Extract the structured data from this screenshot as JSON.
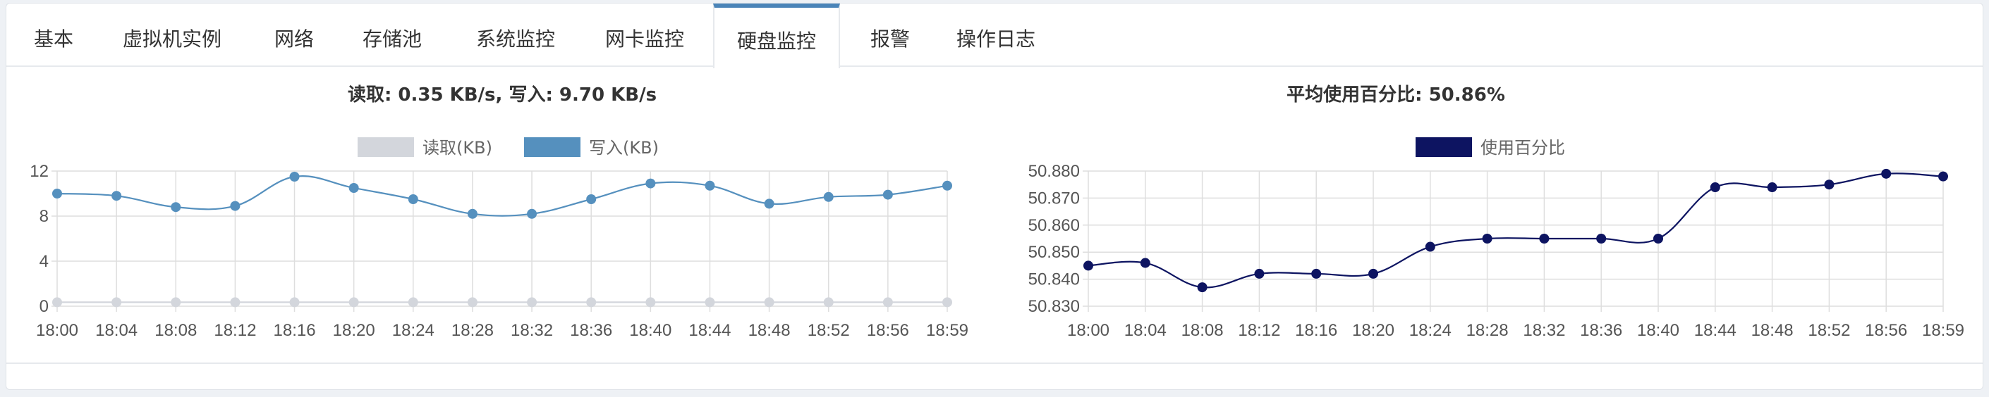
{
  "tabs": [
    {
      "id": "basic",
      "label": "基本"
    },
    {
      "id": "vm",
      "label": "虚拟机实例"
    },
    {
      "id": "network",
      "label": "网络"
    },
    {
      "id": "storage",
      "label": "存储池"
    },
    {
      "id": "sysmon",
      "label": "系统监控"
    },
    {
      "id": "nicmon",
      "label": "网卡监控"
    },
    {
      "id": "diskmon",
      "label": "硬盘监控"
    },
    {
      "id": "alarm",
      "label": "报警"
    },
    {
      "id": "oplog",
      "label": "操作日志"
    }
  ],
  "active_tab": "diskmon",
  "colors": {
    "read": "#d3d6dc",
    "write": "#5590be",
    "usage": "#0d1461",
    "active_tab_border": "#4a84b8"
  },
  "chart_data": [
    {
      "type": "line",
      "title": "读取: 0.35 KB/s, 写入: 9.70 KB/s",
      "categories": [
        "18:00",
        "18:04",
        "18:08",
        "18:12",
        "18:16",
        "18:20",
        "18:24",
        "18:28",
        "18:32",
        "18:36",
        "18:40",
        "18:44",
        "18:48",
        "18:52",
        "18:56",
        "18:59"
      ],
      "series": [
        {
          "name": "读取(KB)",
          "color": "#d3d6dc",
          "values": [
            0.35,
            0.35,
            0.35,
            0.35,
            0.35,
            0.35,
            0.35,
            0.35,
            0.35,
            0.35,
            0.35,
            0.35,
            0.35,
            0.35,
            0.35,
            0.35
          ]
        },
        {
          "name": "写入(KB)",
          "color": "#5590be",
          "values": [
            10.0,
            9.8,
            8.8,
            8.9,
            11.5,
            10.5,
            9.5,
            8.2,
            8.2,
            9.5,
            10.9,
            10.7,
            9.1,
            9.7,
            9.9,
            10.7
          ]
        }
      ],
      "yticks": [
        "0",
        "4",
        "8",
        "12"
      ],
      "ylim": [
        0,
        12
      ],
      "legend": "top-center",
      "grid": true
    },
    {
      "type": "line",
      "title": "平均使用百分比: 50.86%",
      "categories": [
        "18:00",
        "18:04",
        "18:08",
        "18:12",
        "18:16",
        "18:20",
        "18:24",
        "18:28",
        "18:32",
        "18:36",
        "18:40",
        "18:44",
        "18:48",
        "18:52",
        "18:56",
        "18:59"
      ],
      "series": [
        {
          "name": "使用百分比",
          "color": "#0d1461",
          "values": [
            50.845,
            50.846,
            50.837,
            50.842,
            50.842,
            50.842,
            50.852,
            50.855,
            50.855,
            50.855,
            50.855,
            50.874,
            50.874,
            50.875,
            50.879,
            50.878
          ]
        }
      ],
      "yticks": [
        "50.830",
        "50.840",
        "50.850",
        "50.860",
        "50.870",
        "50.880"
      ],
      "ylim": [
        50.83,
        50.88
      ],
      "legend": "top-center",
      "grid": true
    }
  ]
}
